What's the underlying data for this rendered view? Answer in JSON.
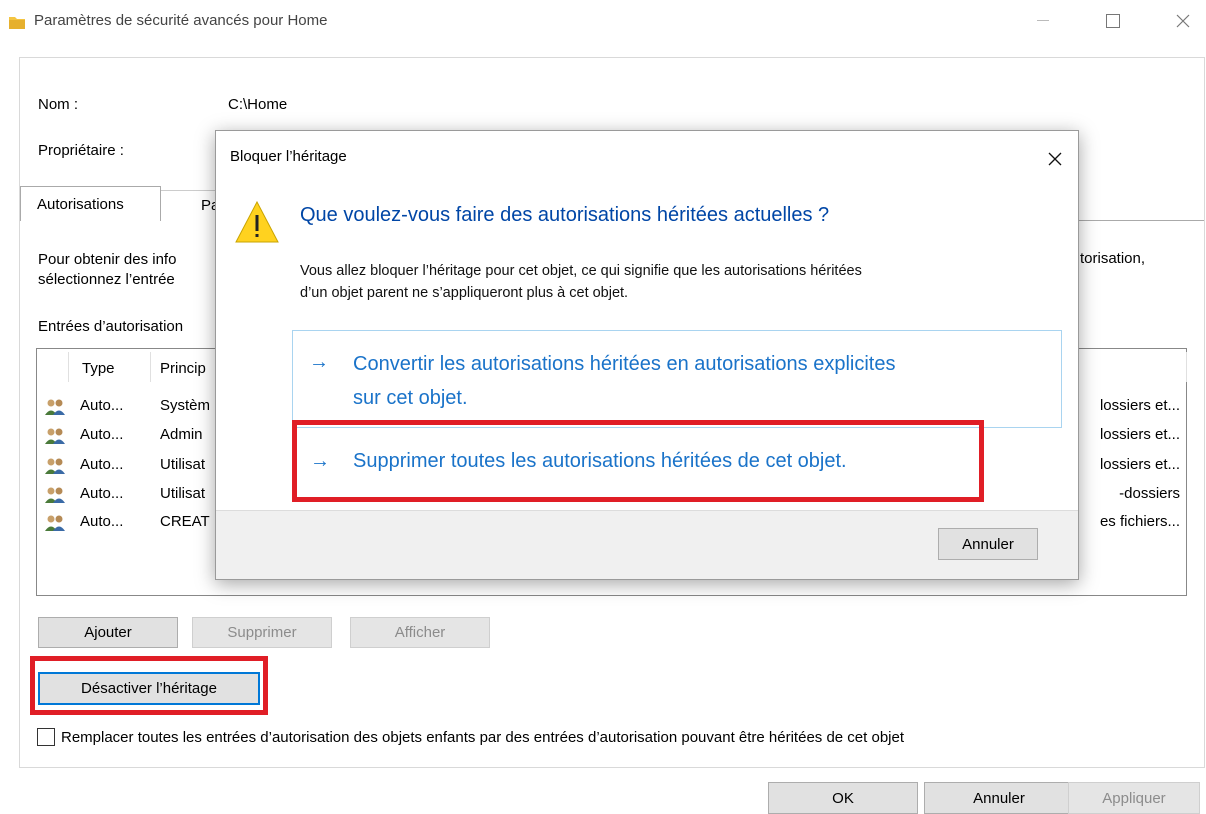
{
  "window": {
    "title": "Paramètres de sécurité avancés pour Home"
  },
  "fields": {
    "name_label": "Nom :",
    "name_value": "C:\\Home",
    "owner_label": "Propriétaire :"
  },
  "tabs": [
    {
      "label": "Autorisations"
    },
    {
      "label": "Pa"
    }
  ],
  "description": {
    "line1": "Pour obtenir des info",
    "line2": "sélectionnez l’entrée",
    "right": "torisation,"
  },
  "entries_label": "Entrées d’autorisation",
  "table": {
    "headers": {
      "type": "Type",
      "principal": "Princip"
    },
    "rows": [
      {
        "type": "Auto...",
        "principal": "Systèm",
        "applies": "lossiers et..."
      },
      {
        "type": "Auto...",
        "principal": "Admin",
        "applies": "lossiers et..."
      },
      {
        "type": "Auto...",
        "principal": "Utilisat",
        "applies": "lossiers et..."
      },
      {
        "type": "Auto...",
        "principal": "Utilisat",
        "applies": "-dossiers"
      },
      {
        "type": "Auto...",
        "principal": "CREAT",
        "applies": "es fichiers..."
      }
    ]
  },
  "buttons": {
    "add": "Ajouter",
    "remove": "Supprimer",
    "view": "Afficher",
    "disable_inheritance": "Désactiver l’héritage",
    "ok": "OK",
    "cancel": "Annuler",
    "apply": "Appliquer"
  },
  "checkbox": {
    "label": "Remplacer toutes les entrées d’autorisation des objets enfants par des entrées d’autorisation pouvant être héritées de cet objet",
    "checked": false
  },
  "dialog": {
    "title": "Bloquer l’héritage",
    "heading": "Que voulez-vous faire des autorisations héritées actuelles ?",
    "body_line1": "Vous allez bloquer l’héritage pour cet objet, ce qui signifie que les autorisations héritées",
    "body_line2": "d’un objet parent ne s’appliqueront plus à cet objet.",
    "option1_line1": "Convertir les autorisations héritées en autorisations explicites",
    "option1_line2": "sur cet objet.",
    "option2": "Supprimer toutes les autorisations héritées de cet objet.",
    "arrow": "→",
    "cancel": "Annuler"
  },
  "colors": {
    "highlight_red": "#e01e26",
    "link_blue": "#1a73c9",
    "heading_blue": "#0046a6",
    "focus_blue": "#0078d7"
  }
}
